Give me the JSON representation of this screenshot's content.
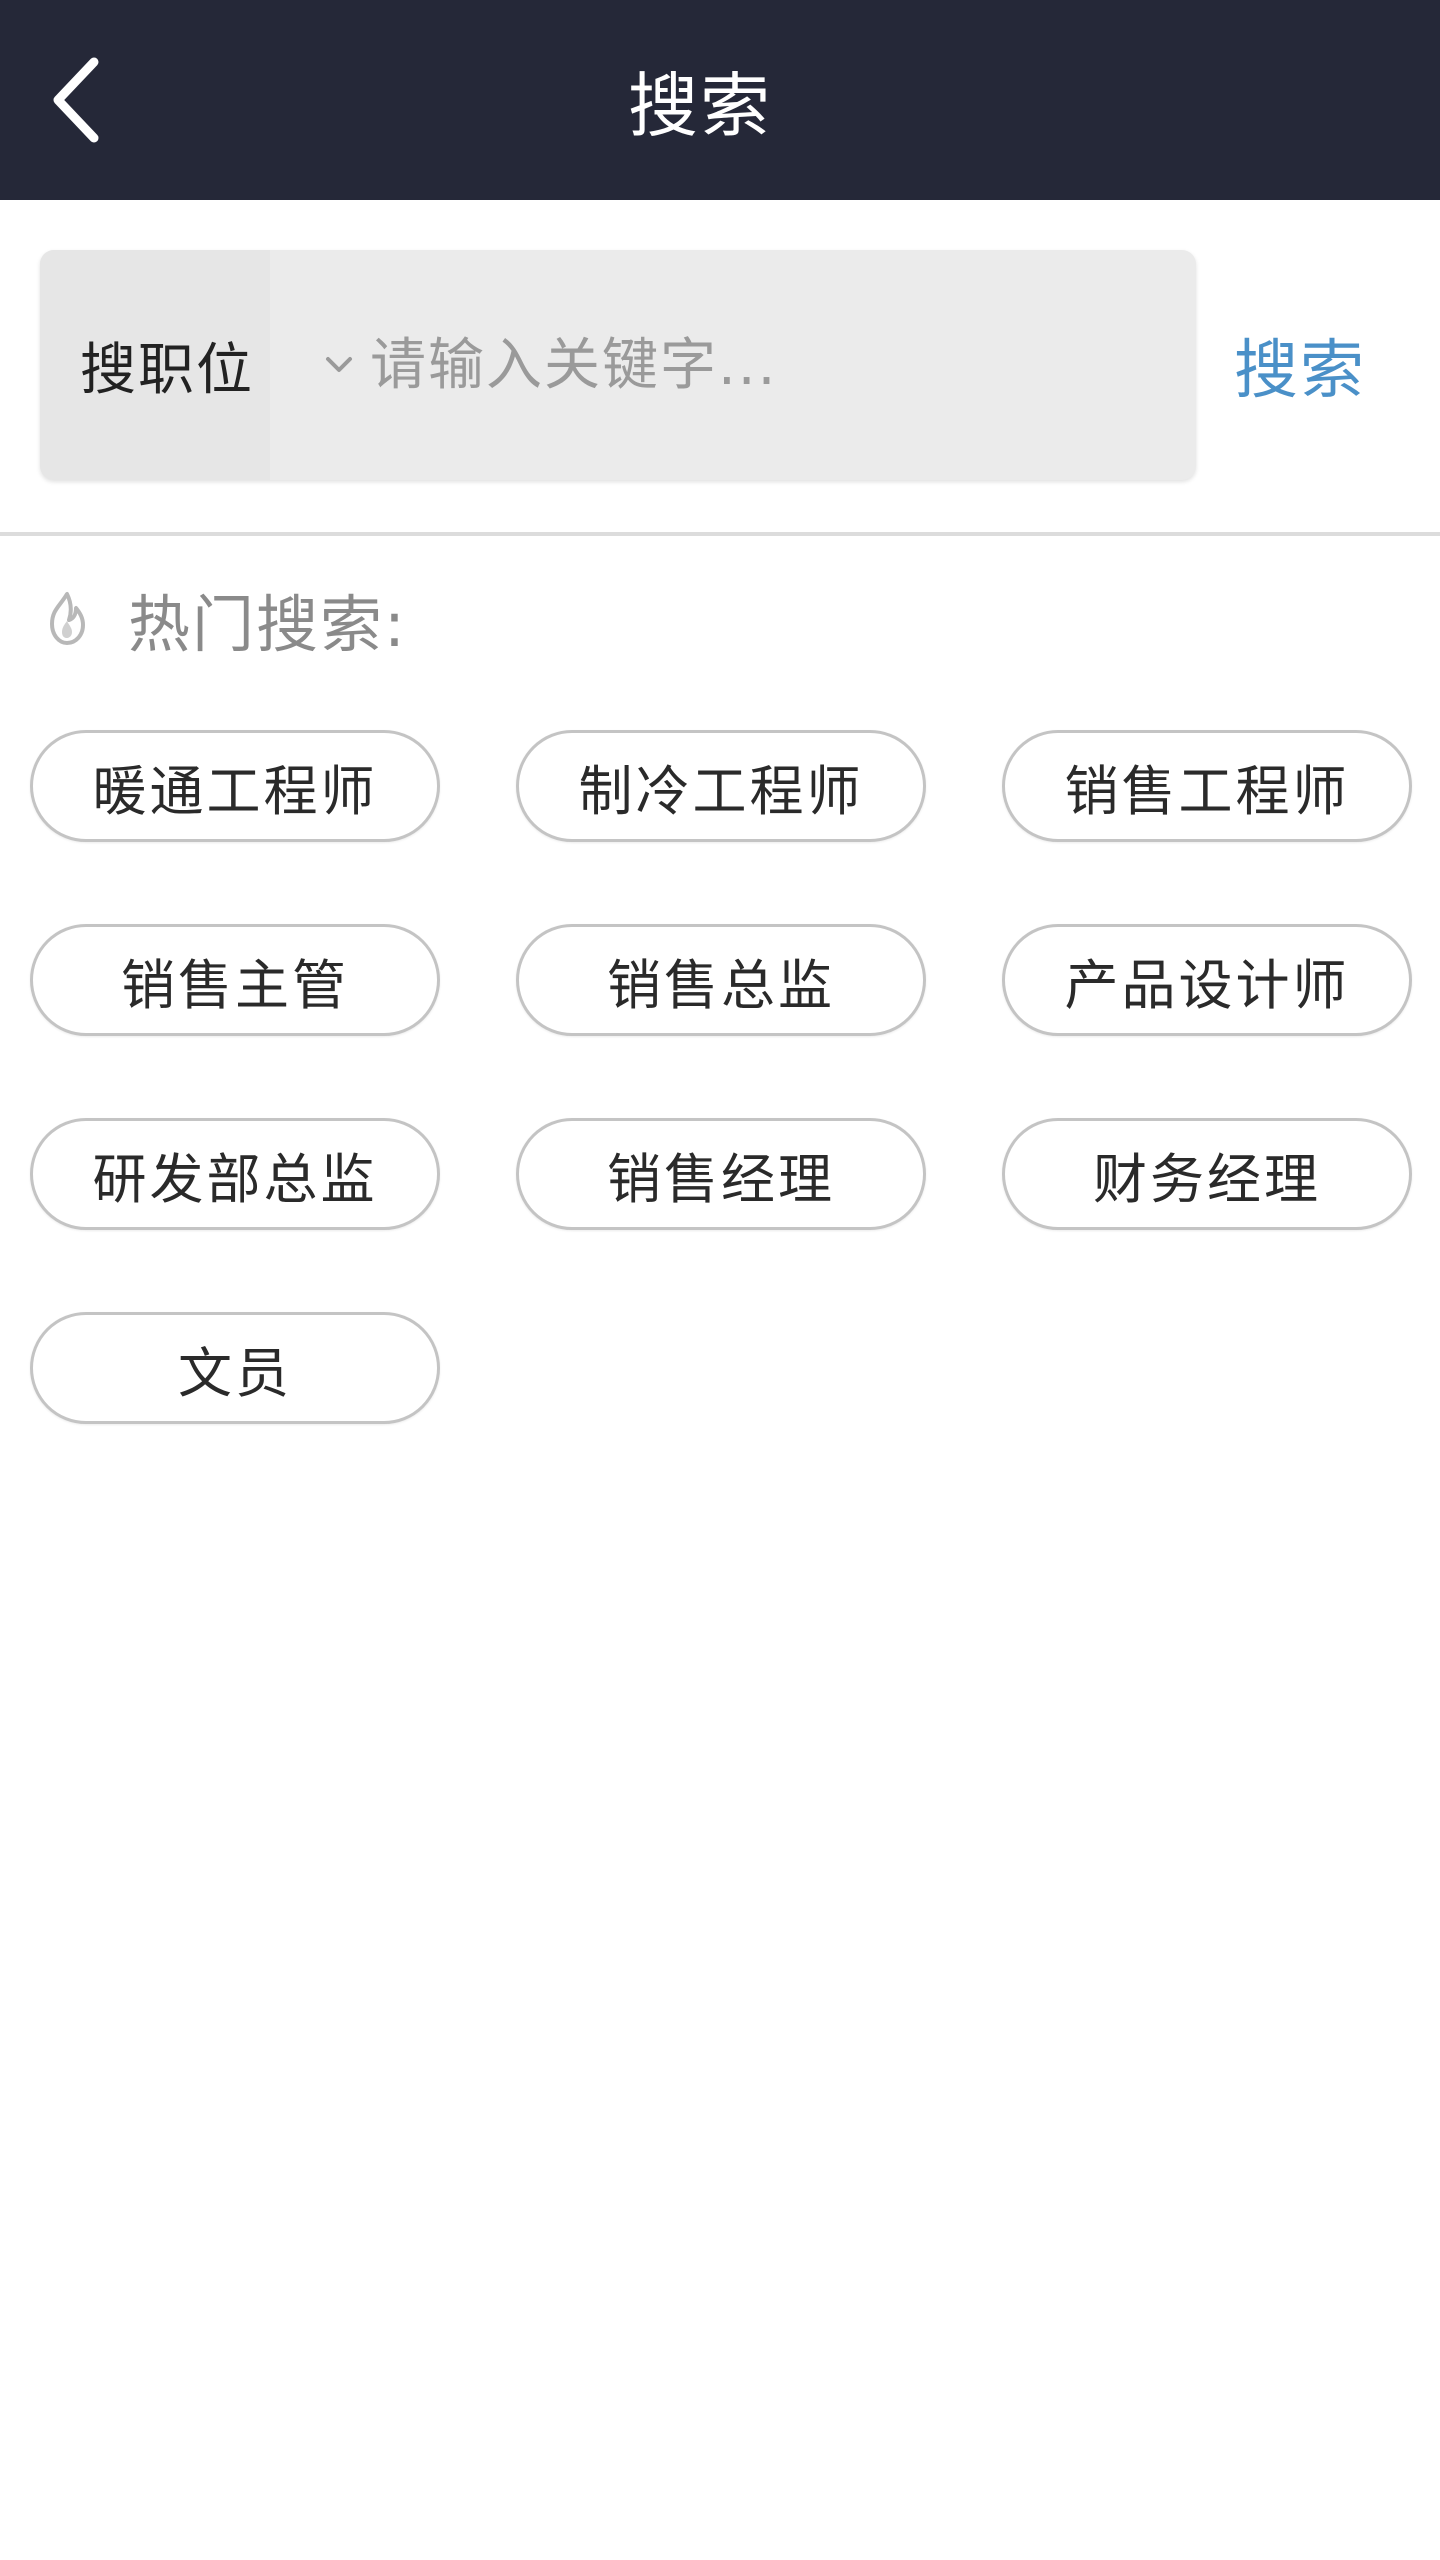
{
  "header": {
    "title": "搜索",
    "back_icon": "chevron-left-icon"
  },
  "search": {
    "category_label": "搜职位",
    "category_icon": "chevron-down-icon",
    "placeholder": "请输入关键字...",
    "value": "",
    "button_label": "搜索"
  },
  "hot": {
    "icon": "flame-icon",
    "label": "热门搜索:",
    "tags": [
      "暖通工程师",
      "制冷工程师",
      "销售工程师",
      "销售主管",
      "销售总监",
      "产品设计师",
      "研发部总监",
      "销售经理",
      "财务经理",
      "文员"
    ]
  },
  "colors": {
    "header_bg": "#252838",
    "accent": "#4a90c8",
    "search_bg": "#ebebeb",
    "tag_border": "#c4c4c4"
  }
}
